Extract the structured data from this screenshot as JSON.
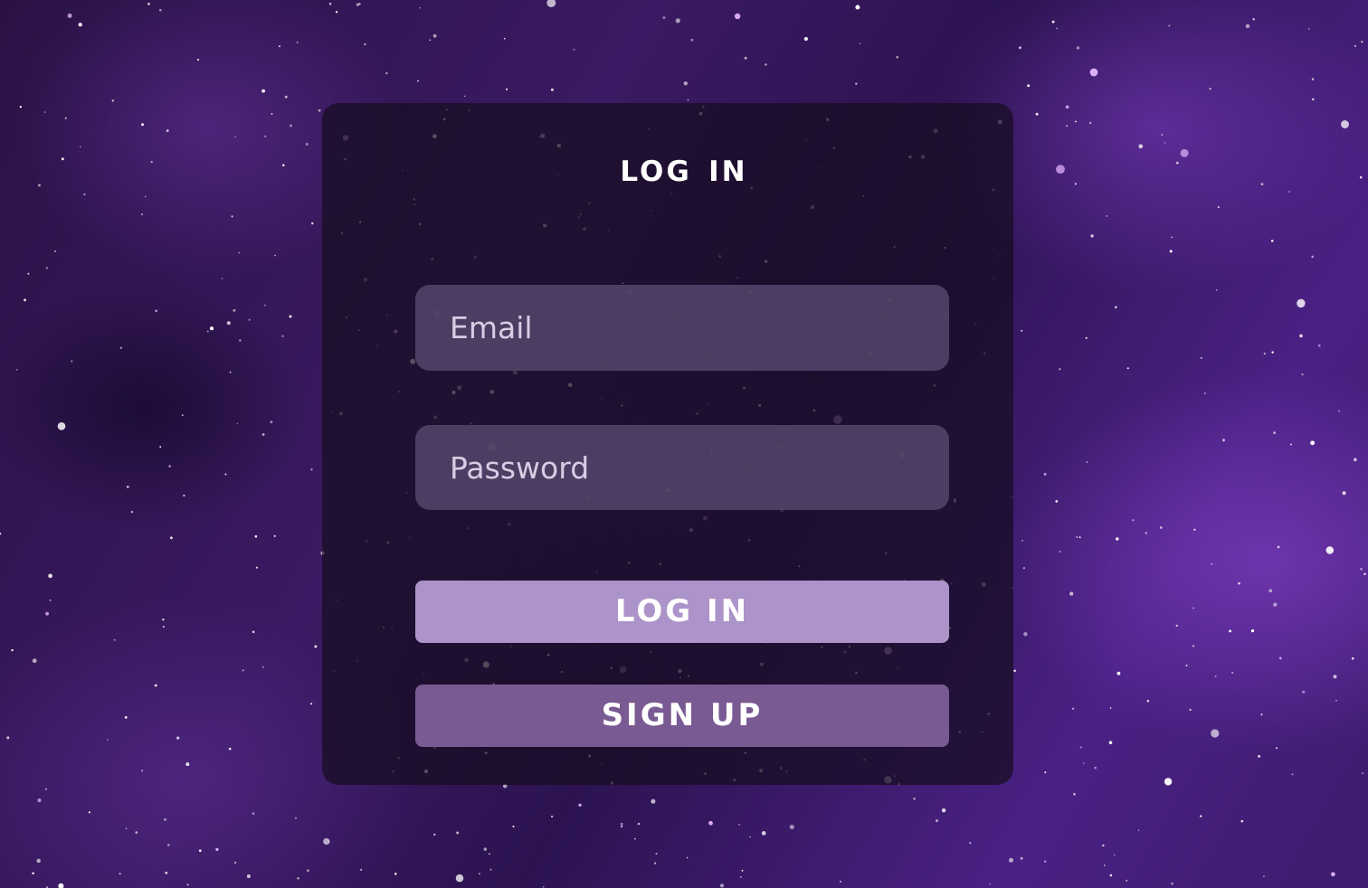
{
  "login_form": {
    "title": "LOG IN",
    "email_placeholder": "Email",
    "password_placeholder": "Password",
    "login_button": "LOG IN",
    "signup_button": "SIGN UP"
  },
  "colors": {
    "background": "#2c1350",
    "card_background": "#160c20",
    "input_background": "#58486e",
    "login_button": "#ac93c9",
    "signup_button": "#7a5a92",
    "text": "#ffffff"
  }
}
